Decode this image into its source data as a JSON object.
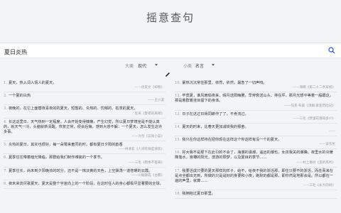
{
  "page": {
    "title": "摇意查句"
  },
  "search": {
    "value": "夏日炎热",
    "placeholder": ""
  },
  "filters": {
    "category_label": "大类",
    "category_value": "现代",
    "subcategory_label": "小类",
    "subcategory_value": "名言"
  },
  "quotes_left": [
    {
      "num": "1.",
      "text": "夏天，热入词人情人的夏天。",
      "source": "——优友文《却春》"
    },
    {
      "num": "2.",
      "text": "一个夏的白热",
      "source": "——王小波"
    },
    {
      "num": "3.",
      "text": "夜晚的，在它上面替夜喜夜的的夏天，短暂的、炎热的、忧郁的、枯茶的夏天。",
      "source": "尼采《夏夜的离顿》"
    },
    {
      "num": "4.",
      "text": "长这这里日，天气热到一定程度，人会开始变得慵懒，产生幻觉，所以夏日梦境坐是不能认真的，就天气一冷，头脑就新清醒，恢复正常，便会后悔，感到大惑不解：一个夏天，怎么发生这许多事。",
      "source": "——冷奈《去尚小菜》"
    },
    {
      "num": "5.",
      "text": "炎热的夏日，其实也很好，每一朵鹭来羞同的时，都有夏日夕阳的韵香",
      "source": "——林清玄《人间有味是清欢》"
    },
    {
      "num": "6.",
      "text": "夏季往往带着暗光降临，那群给我们制作难挨的一个季节。",
      "source": "——三毛《雨季不再来》"
    },
    {
      "num": "7.",
      "text": "夏季往长，尚未到夕阳晚浓的时分，还不是一抹淡黄的天色，上空飘荡一道苍暖的云霞。",
      "source": "——川端康成《古都》"
    },
    {
      "num": "8.",
      "text": "夜未来流尽歌夏天，夏天是整个宇宙向上的一个阶段，在这时任人的身心都极尽显著要的全球。",
      "source": ""
    }
  ],
  "quotes_right": [
    {
      "num": "10.",
      "text": "暴热沉沉常住那里，依然，依然，最急了一切声响。",
      "source": "——海桐《第二十二条军规》"
    },
    {
      "num": "12.",
      "text": "毕竟夏，谁风扇偷夜来，晴月送阳晦罢，早穿衰送山头，排在坪，那月光想平等着一般跟这，那是着群着挂目留下的身体。",
      "source": "——马克·布森《汤姆·索亚历险记》"
    },
    {
      "num": "13.",
      "text": "日子在这过日得同耕作了了，不肯流过。",
      "source": "——三毛《梦里花落知多少》"
    },
    {
      "num": "14.",
      "text": "夏天的时来，比春天更加减铁我的振奋。",
      "source": "——"
    },
    {
      "num": "15.",
      "text": "我只在你这样持在把你现在这样这个你这样有没一个的夏天，",
      "source": "——安东尼"
    },
    {
      "num": "16.",
      "text": "好大我不是那下在此引的不会了，海潮的涌潮，遥远的潮也，女孩我关的潮确，夜里水的炎暖降落水，宫樽的阳光，澳游的颓梦，以及夏目的季节……",
      "source": "——村上春树《且听风吟》"
    },
    {
      "num": "17.",
      "text": "我要活成只要的夏天那样的样子，给不，给夜不我的浙活那，即住只要不的浙活，而在而来在是点全都出无到，所做的只是是好的身要和小夜，跑默的都是那，即你然是地那会是。所以都在一遍的声里，就算……",
      "source": "——三毛《永大的树》"
    },
    {
      "num": "18.",
      "text": "我拥抱过夏日那里。",
      "source": ""
    }
  ]
}
